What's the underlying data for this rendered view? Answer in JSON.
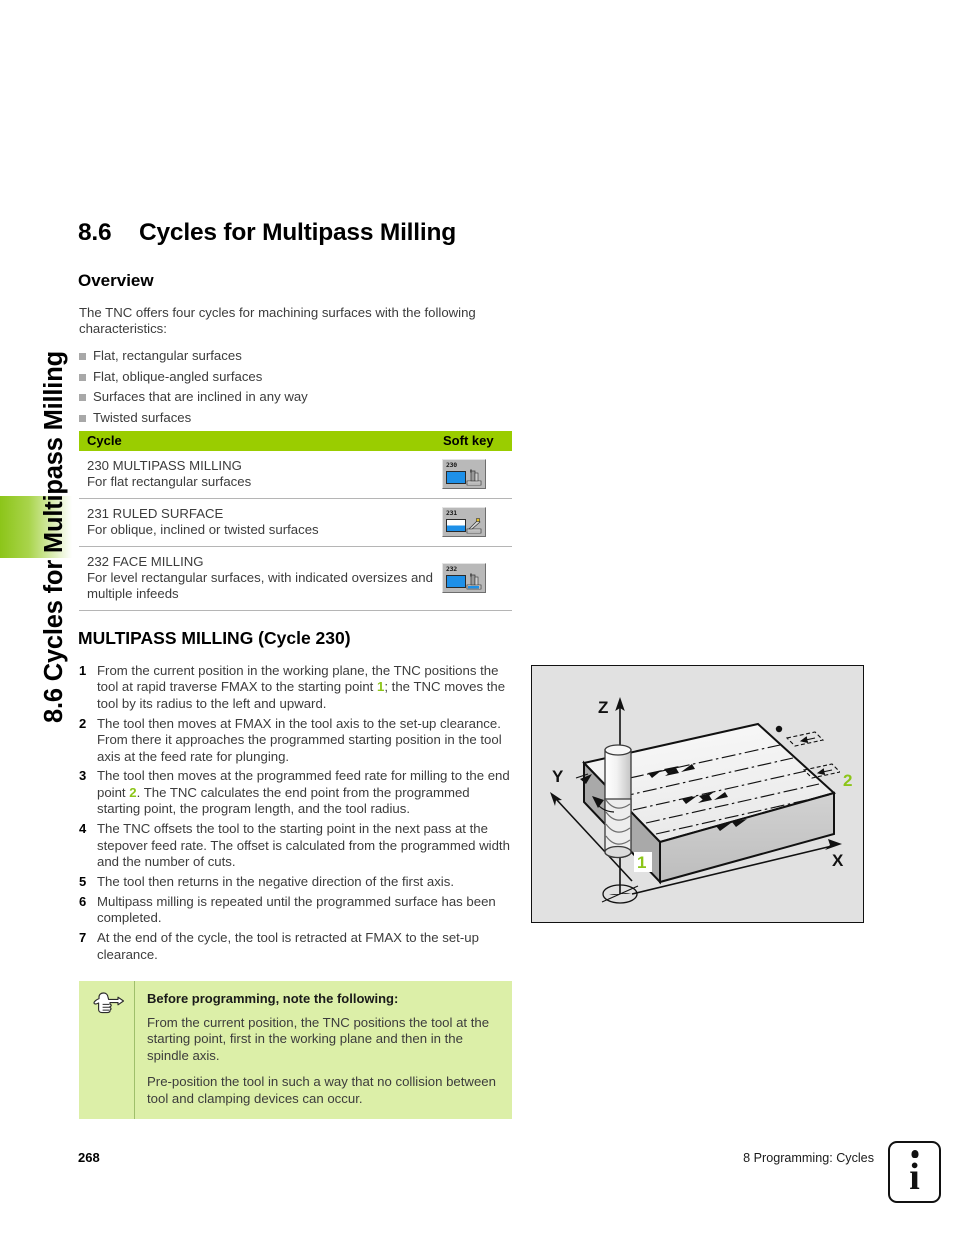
{
  "side_tab": {
    "title": "8.6 Cycles for Multipass Milling"
  },
  "section": {
    "number": "8.6",
    "title": "Cycles for Multipass Milling"
  },
  "overview": {
    "heading": "Overview",
    "intro": "The TNC offers four cycles for machining surfaces with the following characteristics:",
    "bullets": [
      "Flat, rectangular surfaces",
      "Flat, oblique-angled surfaces",
      "Surfaces that are inclined in any way",
      "Twisted surfaces"
    ]
  },
  "table": {
    "headers": {
      "cycle": "Cycle",
      "softkey": "Soft key"
    },
    "header_color": "#9ACD00",
    "rows": [
      {
        "title": "230 MULTIPASS MILLING",
        "desc": "For flat rectangular surfaces",
        "softkey_number": "230",
        "softkey_style": "full"
      },
      {
        "title": "231 RULED SURFACE",
        "desc": "For oblique, inclined or twisted surfaces",
        "softkey_number": "231",
        "softkey_style": "half"
      },
      {
        "title": "232 FACE MILLING",
        "desc": "For level rectangular surfaces, with indicated oversizes and multiple infeeds",
        "softkey_number": "232",
        "softkey_style": "full"
      }
    ]
  },
  "multipass": {
    "heading": "MULTIPASS MILLING (Cycle 230)",
    "steps": [
      {
        "num": "1",
        "parts": [
          {
            "t": "From the current position in the working plane, the TNC positions the tool at rapid traverse FMAX to the starting point "
          },
          {
            "t": "1",
            "ref": true
          },
          {
            "t": "; the TNC moves the tool by its radius to the left and upward."
          }
        ]
      },
      {
        "num": "2",
        "parts": [
          {
            "t": "The tool then moves at FMAX in the tool axis to the set-up clearance. From there it approaches the programmed starting position in the tool axis at the feed rate for plunging."
          }
        ]
      },
      {
        "num": "3",
        "parts": [
          {
            "t": "The tool then moves at the programmed feed rate for milling to the end point "
          },
          {
            "t": "2",
            "ref": true
          },
          {
            "t": ". The TNC calculates the end point from the programmed starting point, the program length, and the tool radius."
          }
        ]
      },
      {
        "num": "4",
        "parts": [
          {
            "t": "The TNC offsets the tool to the starting point in the next pass at the stepover feed rate. The offset is calculated from the programmed width and the number of cuts."
          }
        ]
      },
      {
        "num": "5",
        "parts": [
          {
            "t": "The tool then returns in the negative direction of the first axis."
          }
        ]
      },
      {
        "num": "6",
        "parts": [
          {
            "t": "Multipass milling is repeated until the programmed surface has been completed."
          }
        ]
      },
      {
        "num": "7",
        "parts": [
          {
            "t": "At the end of the cycle, the tool is retracted at FMAX to the set-up clearance."
          }
        ]
      }
    ]
  },
  "note": {
    "icon": "pointing-hand-icon",
    "title": "Before programming, note the following:",
    "paragraphs": [
      "From the current position, the TNC positions the tool at the starting point, first in the working plane and then in the spindle axis.",
      "Pre-position the tool in such a way that no collision between tool and clamping devices can occur."
    ],
    "background_color": "#DCEFA8"
  },
  "figure": {
    "name": "multipass-milling-diagram",
    "axis_labels": {
      "z": "Z",
      "y": "Y",
      "x": "X"
    },
    "markers": [
      {
        "label": "1",
        "meaning": "starting point"
      },
      {
        "label": "2",
        "meaning": "end point"
      }
    ],
    "marker_color": "#8CC519",
    "background_color": "#E1E1E1"
  },
  "footer": {
    "page": "268",
    "chapter": "8 Programming: Cycles",
    "info_icon": "info-icon"
  }
}
